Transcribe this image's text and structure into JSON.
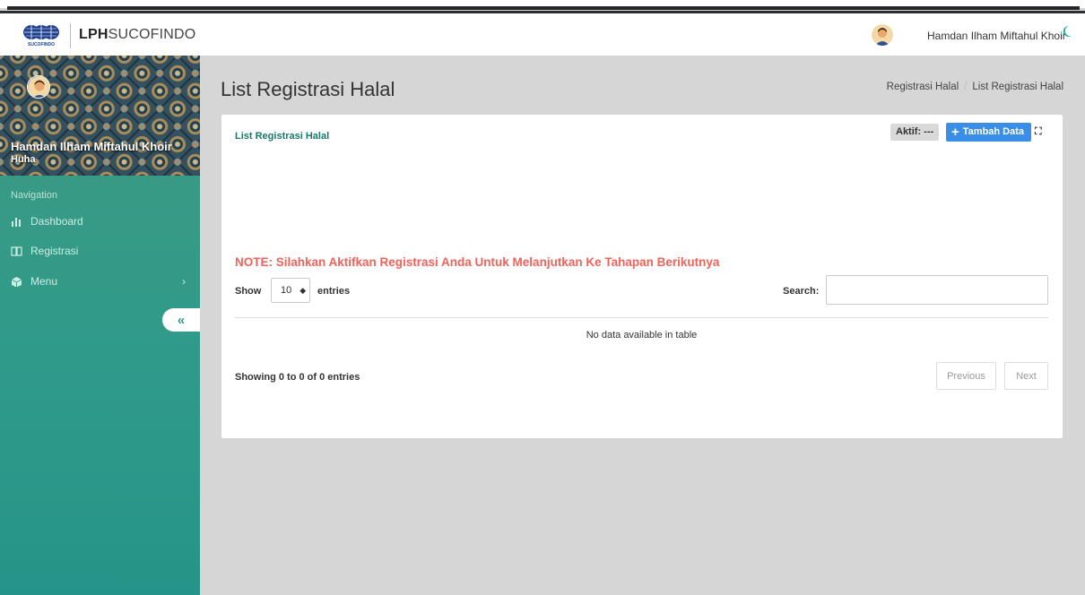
{
  "header": {
    "brand_bold": "LPH",
    "brand_rest": "SUCOFINDO",
    "user_name": "Hamdan Ilham Miftahul Khoir",
    "logo_caption": "SUCOFINDO"
  },
  "sidebar": {
    "profile_name": "Hamdan Ilham Miftahul Khoir",
    "profile_role": "Huha",
    "nav_title": "Navigation",
    "items": [
      {
        "label": "Dashboard",
        "icon": "bar-chart-icon"
      },
      {
        "label": "Registrasi",
        "icon": "book-icon"
      },
      {
        "label": "Menu",
        "icon": "cube-icon"
      }
    ],
    "collapse_label": "«"
  },
  "page": {
    "title": "List Registrasi Halal",
    "breadcrumb": [
      "Registrasi Halal",
      "List Registrasi Halal"
    ]
  },
  "card": {
    "title": "List Registrasi Halal",
    "aktif_label": "Aktif: ---",
    "add_label": "Tambah Data",
    "note": "NOTE: Silahkan Aktifkan Registrasi Anda Untuk Melanjutkan Ke Tahapan Berikutnya",
    "table": {
      "show_label": "Show",
      "show_value": "10",
      "entries_label": "entries",
      "search_label": "Search:",
      "search_value": "",
      "empty_message": "No data available in table",
      "info": "Showing 0 to 0 of 0 entries",
      "prev_label": "Previous",
      "next_label": "Next"
    }
  },
  "colors": {
    "sidebar": "#2f9a8b",
    "accent_blue": "#3a8ee6",
    "note_red": "#f0625a",
    "title_green": "#167a6a"
  }
}
